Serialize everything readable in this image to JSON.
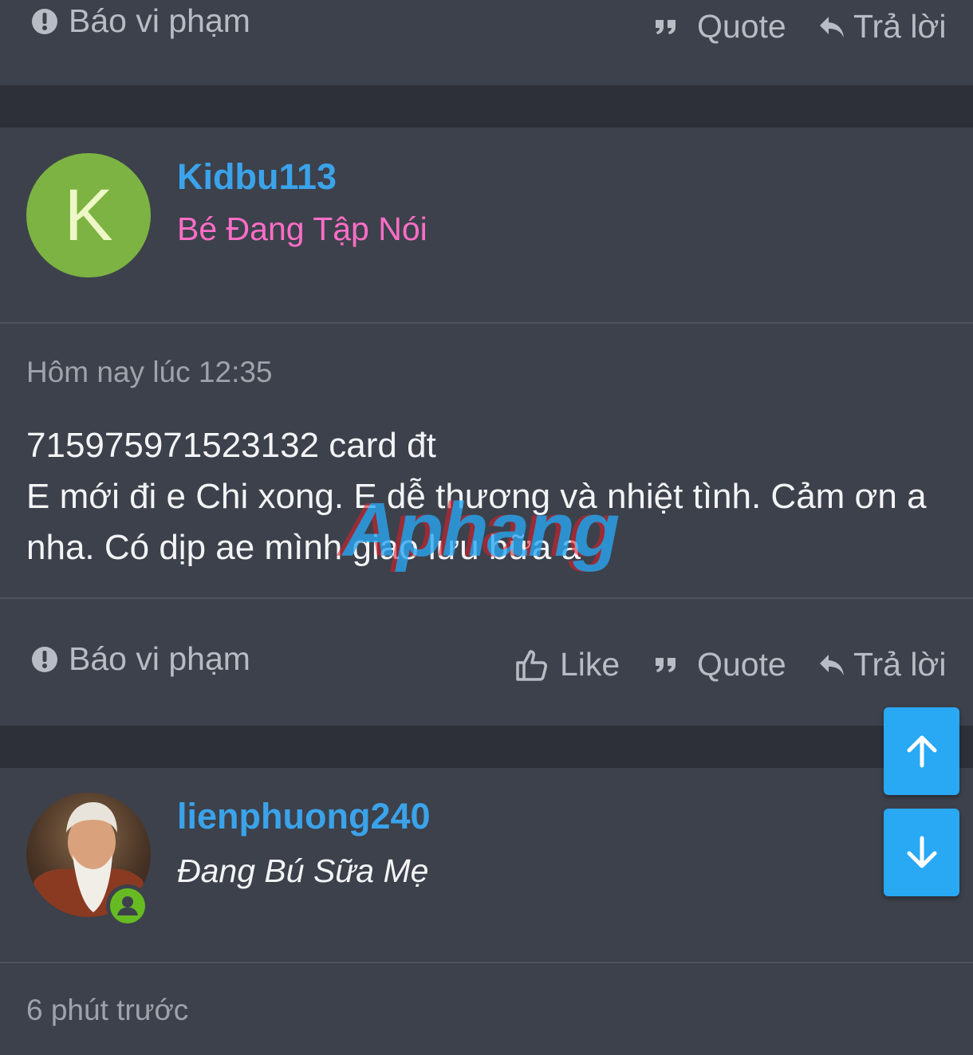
{
  "post1_footer": {
    "report_label": "Báo vi phạm",
    "quote_label": "Quote",
    "reply_label": "Trả lời"
  },
  "post2": {
    "avatar_letter": "K",
    "avatar_color": "#7cb342",
    "username": "Kidbu113",
    "user_title": "Bé Đang Tập Nói",
    "user_title_color": "#ff6ec7",
    "timestamp": "Hôm nay lúc 12:35",
    "body_line1": "715975971523132 card đt",
    "body_line2": "E mới đi e Chi xong. E dễ thương và nhiệt tình. Cảm ơn a nha. Có dịp ae mình giao lưu bữa a",
    "watermark": "Aphang",
    "report_label": "Báo vi phạm",
    "like_label": "Like",
    "quote_label": "Quote",
    "reply_label": "Trả lời"
  },
  "post3": {
    "username": "lienphuong240",
    "user_title": "Đang Bú Sữa Mẹ",
    "timestamp": "6 phút trước",
    "online_icon": "user-online-icon"
  },
  "scroll": {
    "up_icon": "arrow-up-icon",
    "down_icon": "arrow-down-icon"
  },
  "colors": {
    "background": "#2d3038",
    "card": "#3d414b",
    "link": "#3aa3ea",
    "scroll_button": "#29a8f4"
  }
}
